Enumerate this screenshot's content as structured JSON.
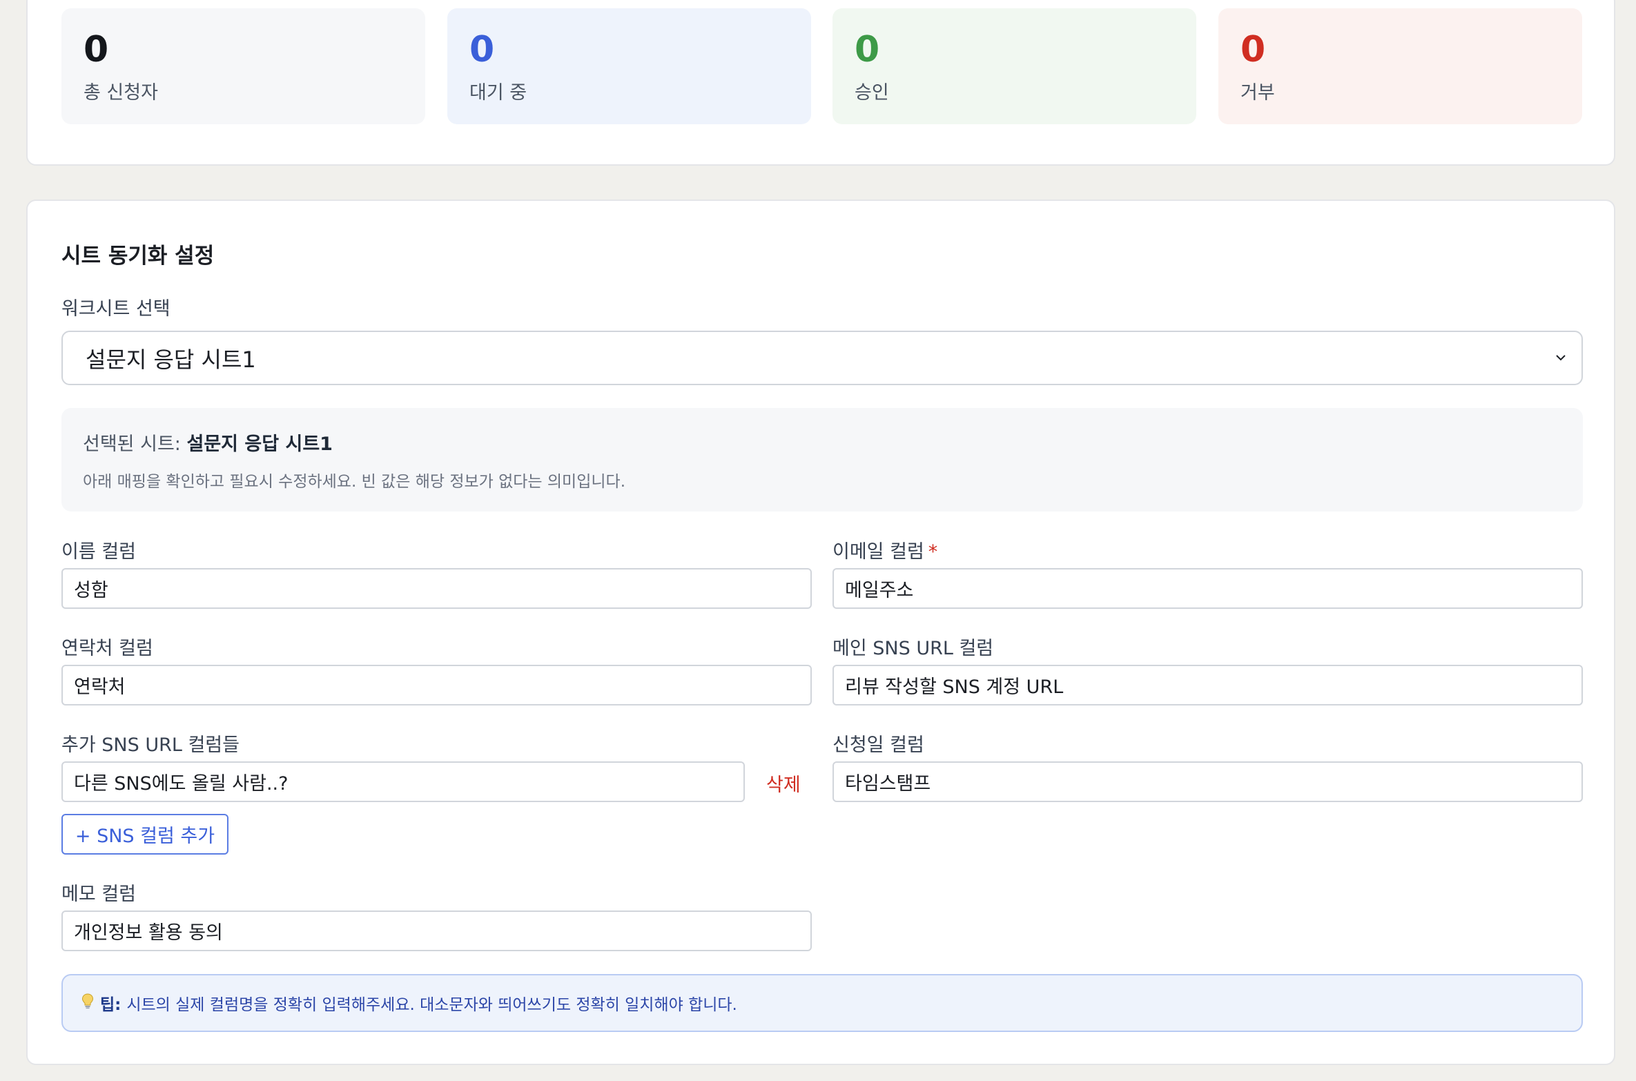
{
  "stats": [
    {
      "value": "0",
      "label": "총 신청자"
    },
    {
      "value": "0",
      "label": "대기 중"
    },
    {
      "value": "0",
      "label": "승인"
    },
    {
      "value": "0",
      "label": "거부"
    }
  ],
  "sync": {
    "title": "시트 동기화 설정",
    "worksheet_label": "워크시트 선택",
    "worksheet_value": "설문지 응답 시트1",
    "selected_prefix": "선택된 시트:",
    "selected_name": "설문지 응답 시트1",
    "selected_help": "아래 매핑을 확인하고 필요시 수정하세요. 빈 값은 해당 정보가 없다는 의미입니다.",
    "fields": {
      "name": {
        "label": "이름 컬럼",
        "value": "성함"
      },
      "email": {
        "label": "이메일 컬럼",
        "required_mark": "*",
        "value": "메일주소"
      },
      "phone": {
        "label": "연락처 컬럼",
        "value": "연락처"
      },
      "main_sns": {
        "label": "메인 SNS URL 컬럼",
        "value": "리뷰 작성할 SNS 계정 URL"
      },
      "extra_sns": {
        "label": "추가 SNS URL 컬럼들",
        "value": "다른 SNS에도 올릴 사람..?",
        "delete_label": "삭제",
        "add_label": "+ SNS 컬럼 추가"
      },
      "date": {
        "label": "신청일 컬럼",
        "value": "타임스탬프"
      },
      "memo": {
        "label": "메모 컬럼",
        "value": "개인정보 활용 동의"
      }
    },
    "tip": {
      "icon": "lightbulb-icon",
      "label": "팁:",
      "text": "시트의 실제 컬럼명을 정확히 입력해주세요. 대소문자와 띄어쓰기도 정확히 일치해야 합니다."
    }
  },
  "colors": {
    "pending": "#3a5fd9",
    "approved": "#3d9a47",
    "rejected": "#d02e22",
    "background": "#f1f0ec"
  }
}
